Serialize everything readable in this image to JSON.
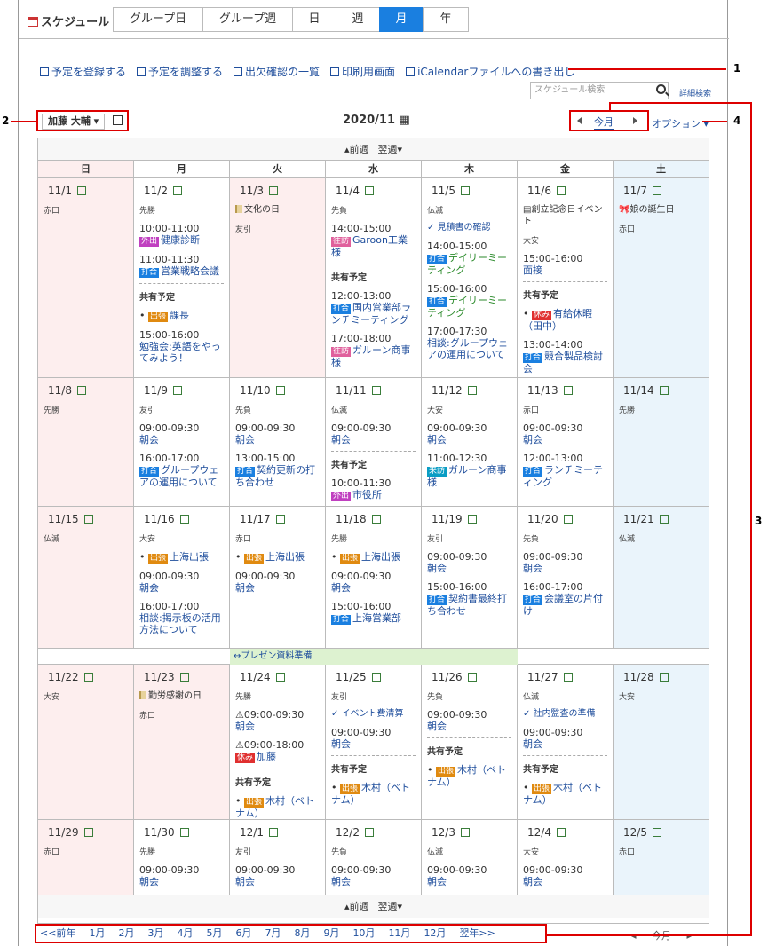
{
  "app": {
    "title": "スケジュール",
    "tabs": [
      "グループ日",
      "グループ週",
      "日",
      "週",
      "月",
      "年"
    ],
    "active_tab": "月"
  },
  "toolbar": [
    "予定を登録する",
    "予定を調整する",
    "出欠確認の一覧",
    "印刷用画面",
    "iCalendarファイルへの書き出し"
  ],
  "search": {
    "placeholder": "スケジュール検索",
    "advanced": "詳細検索"
  },
  "user": "加藤 大輔",
  "month": "2020/11",
  "nav": {
    "today": "今月",
    "options": "オプション"
  },
  "weeknav": {
    "prev": "前週",
    "next": "翌週"
  },
  "weekdays": [
    "日",
    "月",
    "火",
    "水",
    "木",
    "金",
    "土"
  ],
  "weeks": [
    {
      "days": [
        {
          "d": "11/1",
          "r": "赤口",
          "type": "sun",
          "events": []
        },
        {
          "d": "11/2",
          "r": "先勝",
          "events": [
            {
              "time": "10:00-11:00",
              "badge": "外出",
              "bc": "b-out",
              "title": "健康診断"
            },
            {
              "time": "11:00-11:30",
              "badge": "打合",
              "bc": "b-meet",
              "title": "営業戦略会議"
            }
          ],
          "shared": [
            {
              "badge": "出張",
              "bc": "b-trip",
              "title": "課長"
            },
            {
              "time": "15:00-16:00",
              "title": "勉強会:英語をやってみよう！"
            }
          ]
        },
        {
          "d": "11/3",
          "r": "友引",
          "type": "hol",
          "holiday": "文化の日",
          "events": []
        },
        {
          "d": "11/4",
          "r": "先負",
          "events": [
            {
              "time": "14:00-15:00",
              "badge": "往訪",
              "bc": "b-visit",
              "title": "Garoon工業様"
            }
          ],
          "shared": [
            {
              "time": "12:00-13:00",
              "badge": "打合",
              "bc": "b-meet",
              "title": "国内営業部ランチミーティング"
            },
            {
              "time": "17:00-18:00",
              "badge": "往訪",
              "bc": "b-visit",
              "title": "ガルーン商事様"
            }
          ]
        },
        {
          "d": "11/5",
          "r": "仏滅",
          "todo": "見積書の確認",
          "events": [
            {
              "time": "14:00-15:00",
              "badge": "打合",
              "bc": "b-meet",
              "title": "デイリーミーティング",
              "green": true
            },
            {
              "time": "15:00-16:00",
              "badge": "打合",
              "bc": "b-meet",
              "title": "デイリーミーティング",
              "green": true
            },
            {
              "time": "17:00-17:30",
              "title": "相談:グループウェアの運用について"
            }
          ]
        },
        {
          "d": "11/6",
          "r": "大安",
          "memo": "創立記念日イベント",
          "events": [
            {
              "time": "15:00-16:00",
              "title": "面接"
            }
          ],
          "shared": [
            {
              "badge": "休み",
              "bc": "b-rest",
              "title": "有給休暇（田中）"
            },
            {
              "time": "13:00-14:00",
              "badge": "打合",
              "bc": "b-meet",
              "title": "競合製品検討会"
            }
          ]
        },
        {
          "d": "11/7",
          "r": "赤口",
          "type": "sat",
          "birthday": "娘の誕生日",
          "events": []
        }
      ]
    },
    {
      "days": [
        {
          "d": "11/8",
          "r": "先勝",
          "type": "sun",
          "events": []
        },
        {
          "d": "11/9",
          "r": "友引",
          "events": [
            {
              "time": "09:00-09:30",
              "title": "朝会"
            },
            {
              "time": "16:00-17:00",
              "badge": "打合",
              "bc": "b-meet",
              "title": "グループウェアの運用について"
            }
          ]
        },
        {
          "d": "11/10",
          "r": "先負",
          "events": [
            {
              "time": "09:00-09:30",
              "title": "朝会"
            },
            {
              "time": "13:00-15:00",
              "badge": "打合",
              "bc": "b-meet",
              "title": "契約更新の打ち合わせ"
            }
          ]
        },
        {
          "d": "11/11",
          "r": "仏滅",
          "events": [
            {
              "time": "09:00-09:30",
              "title": "朝会"
            }
          ],
          "shared": [
            {
              "time": "10:00-11:30",
              "badge": "外出",
              "bc": "b-out",
              "title": "市役所"
            }
          ]
        },
        {
          "d": "11/12",
          "r": "大安",
          "events": [
            {
              "time": "09:00-09:30",
              "title": "朝会"
            },
            {
              "time": "11:00-12:30",
              "badge": "来訪",
              "bc": "b-come",
              "title": "ガルーン商事様"
            }
          ]
        },
        {
          "d": "11/13",
          "r": "赤口",
          "events": [
            {
              "time": "09:00-09:30",
              "title": "朝会"
            },
            {
              "time": "12:00-13:00",
              "badge": "打合",
              "bc": "b-meet",
              "title": "ランチミーティング"
            }
          ]
        },
        {
          "d": "11/14",
          "r": "先勝",
          "type": "sat",
          "events": []
        }
      ]
    },
    {
      "days": [
        {
          "d": "11/15",
          "r": "仏滅",
          "type": "sun",
          "events": []
        },
        {
          "d": "11/16",
          "r": "大安",
          "events": [
            {
              "dot": true,
              "badge": "出張",
              "bc": "b-trip",
              "title": "上海出張"
            },
            {
              "time": "09:00-09:30",
              "title": "朝会"
            },
            {
              "time": "16:00-17:00",
              "title": "相談:掲示板の活用方法について"
            }
          ]
        },
        {
          "d": "11/17",
          "r": "赤口",
          "events": [
            {
              "dot": true,
              "badge": "出張",
              "bc": "b-trip",
              "title": "上海出張"
            },
            {
              "time": "09:00-09:30",
              "title": "朝会"
            }
          ]
        },
        {
          "d": "11/18",
          "r": "先勝",
          "events": [
            {
              "dot": true,
              "badge": "出張",
              "bc": "b-trip",
              "title": "上海出張"
            },
            {
              "time": "09:00-09:30",
              "title": "朝会"
            },
            {
              "time": "15:00-16:00",
              "badge": "打合",
              "bc": "b-meet",
              "title": "上海営業部"
            }
          ]
        },
        {
          "d": "11/19",
          "r": "友引",
          "events": [
            {
              "time": "09:00-09:30",
              "title": "朝会"
            },
            {
              "time": "15:00-16:00",
              "badge": "打合",
              "bc": "b-meet",
              "title": "契約書最終打ち合わせ"
            }
          ]
        },
        {
          "d": "11/20",
          "r": "先負",
          "events": [
            {
              "time": "09:00-09:30",
              "title": "朝会"
            },
            {
              "time": "16:00-17:00",
              "badge": "打合",
              "bc": "b-meet",
              "title": "会議室の片付け"
            }
          ]
        },
        {
          "d": "11/21",
          "r": "仏滅",
          "type": "sat",
          "events": []
        }
      ]
    },
    {
      "banner": "↔プレゼン資料準備",
      "days": [
        {
          "d": "11/22",
          "r": "大安",
          "type": "sun",
          "events": []
        },
        {
          "d": "11/23",
          "r": "赤口",
          "type": "hol",
          "holiday": "勤労感謝の日",
          "events": []
        },
        {
          "d": "11/24",
          "r": "先勝",
          "events": [
            {
              "time": "09:00-09:30",
              "warn": true,
              "title": "朝会"
            },
            {
              "time": "09:00-18:00",
              "warn": true,
              "badge": "休み",
              "bc": "b-rest",
              "title": "加藤"
            }
          ],
          "shared": [
            {
              "badge": "出張",
              "bc": "b-trip",
              "title": "木村（ベトナム）"
            }
          ]
        },
        {
          "d": "11/25",
          "r": "友引",
          "todo": "イベント費清算",
          "events": [
            {
              "time": "09:00-09:30",
              "title": "朝会"
            }
          ],
          "shared": [
            {
              "badge": "出張",
              "bc": "b-trip",
              "title": "木村（ベトナム）"
            }
          ]
        },
        {
          "d": "11/26",
          "r": "先負",
          "events": [
            {
              "time": "09:00-09:30",
              "title": "朝会"
            }
          ],
          "shared": [
            {
              "badge": "出張",
              "bc": "b-trip",
              "title": "木村（ベトナム）"
            }
          ]
        },
        {
          "d": "11/27",
          "r": "仏滅",
          "todo": "社内監査の準備",
          "events": [
            {
              "time": "09:00-09:30",
              "title": "朝会"
            }
          ],
          "shared": [
            {
              "badge": "出張",
              "bc": "b-trip",
              "title": "木村（ベトナム）"
            }
          ]
        },
        {
          "d": "11/28",
          "r": "大安",
          "type": "sat",
          "events": []
        }
      ]
    },
    {
      "days": [
        {
          "d": "11/29",
          "r": "赤口",
          "type": "sun",
          "events": []
        },
        {
          "d": "11/30",
          "r": "先勝",
          "events": [
            {
              "time": "09:00-09:30",
              "title": "朝会"
            }
          ]
        },
        {
          "d": "12/1",
          "r": "友引",
          "events": [
            {
              "time": "09:00-09:30",
              "title": "朝会"
            }
          ]
        },
        {
          "d": "12/2",
          "r": "先負",
          "events": [
            {
              "time": "09:00-09:30",
              "title": "朝会"
            }
          ]
        },
        {
          "d": "12/3",
          "r": "仏滅",
          "events": [
            {
              "time": "09:00-09:30",
              "title": "朝会"
            }
          ]
        },
        {
          "d": "12/4",
          "r": "大安",
          "events": [
            {
              "time": "09:00-09:30",
              "title": "朝会"
            }
          ]
        },
        {
          "d": "12/5",
          "r": "赤口",
          "type": "sat",
          "events": []
        }
      ]
    }
  ],
  "shared_label": "共有予定",
  "months_nav": [
    "<<前年",
    "1月",
    "2月",
    "3月",
    "4月",
    "5月",
    "6月",
    "7月",
    "8月",
    "9月",
    "10月",
    "11月",
    "12月",
    "翌年>>"
  ],
  "callouts": [
    "1",
    "2",
    "3",
    "4"
  ]
}
